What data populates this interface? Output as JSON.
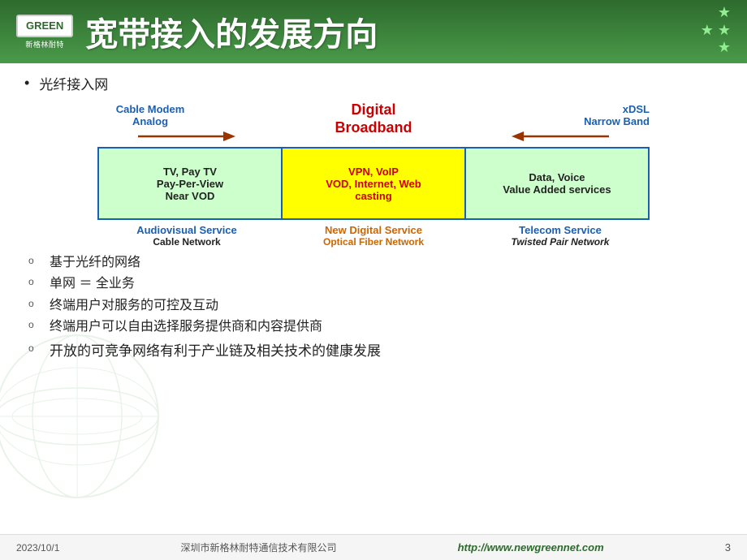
{
  "header": {
    "logo_text": "GREEN",
    "logo_sub": "新格林耐特",
    "title": "宽带接入的发展方向"
  },
  "first_bullet": "光纤接入网",
  "diagram": {
    "label_cable_modem": "Cable Modem",
    "label_analog": "Analog",
    "label_digital_broadband": "Digital\nBroadband",
    "label_xdsl": "xDSL",
    "label_narrow_band": "Narrow Band",
    "box_left_text": "TV, Pay TV\nPay-Per-View\nNear VOD",
    "box_center_text": "VPN, VoIP\nVOD, Internet, Web\ncasting",
    "box_right_text": "Data, Voice\nValue Added services",
    "bottom_left_top": "Audiovisual Service",
    "bottom_left_sub": "Cable Network",
    "bottom_center_top": "New Digital Service",
    "bottom_center_sub": "Optical Fiber Network",
    "bottom_right_top": "Telecom Service",
    "bottom_right_sub": "Twisted Pair Network"
  },
  "bullets": [
    "基于光纤的网络",
    "单网 ＝ 全业务",
    "终端用户对服务的可控及互动",
    "终端用户可以自由选择服务提供商和内容提供商",
    "开放的可竞争网络有利于产业链及相关技术的健康发展"
  ],
  "footer": {
    "date": "2023/10/1",
    "company": "深圳市新格林耐特通信技术有限公司",
    "url": "http://www.newgreennet.com",
    "page": "3"
  }
}
